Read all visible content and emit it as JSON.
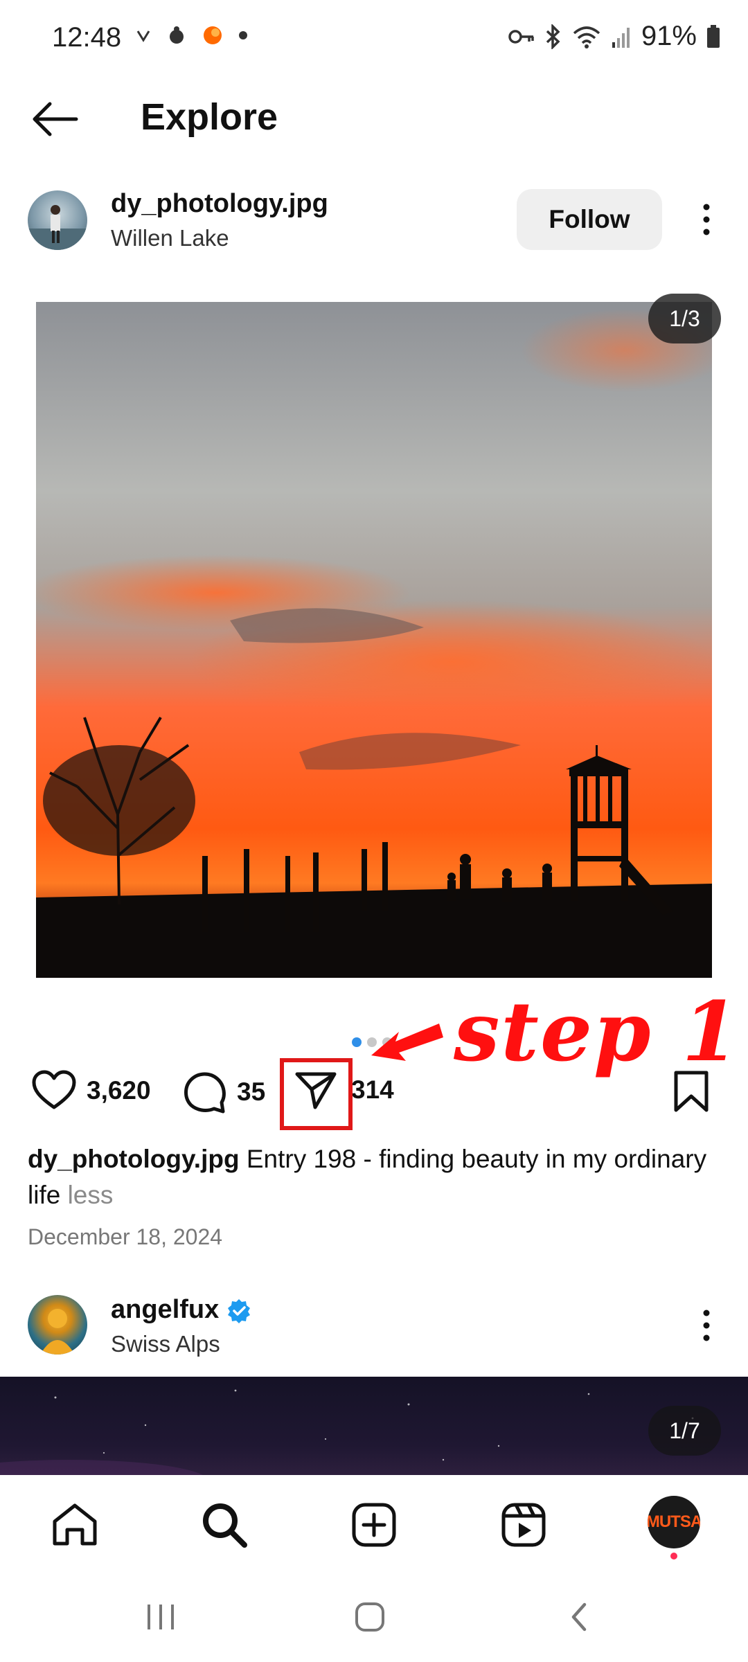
{
  "status_bar": {
    "time": "12:48",
    "battery": "91%",
    "left_icons": [
      "v-icon",
      "app-notification-icon",
      "orange-dot-icon",
      "dot-icon"
    ],
    "right_icons": [
      "key-icon",
      "bluetooth-icon",
      "wifi-icon",
      "signal-icon",
      "battery-icon"
    ]
  },
  "header": {
    "title": "Explore"
  },
  "post": {
    "username": "dy_photology.jpg",
    "location": "Willen Lake",
    "follow_label": "Follow",
    "page_counter": "1/3",
    "likes": "3,620",
    "comments": "35",
    "shares": "314",
    "caption_user": "dy_photology.jpg",
    "caption_text": " Entry 198 - finding beauty in my ordinary life ",
    "caption_less": "less",
    "date": "December 18, 2024",
    "carousel_dots": 3,
    "active_dot": 1
  },
  "annotation": {
    "label": "step 1",
    "color": "#ff1010"
  },
  "post2": {
    "username": "angelfux",
    "location": "Swiss Alps",
    "page_counter": "1/7",
    "verified": true
  },
  "bottom_nav": {
    "items": [
      "home-icon",
      "search-icon",
      "create-icon",
      "reels-icon",
      "profile-avatar"
    ],
    "profile_text": "MUTSA"
  },
  "system_nav": {
    "items": [
      "recents-icon",
      "home-button-icon",
      "back-icon"
    ]
  },
  "colors": {
    "accent_blue": "#2f8fe8",
    "verified_blue": "#1d9bf0",
    "annotation_red": "#e01818"
  }
}
